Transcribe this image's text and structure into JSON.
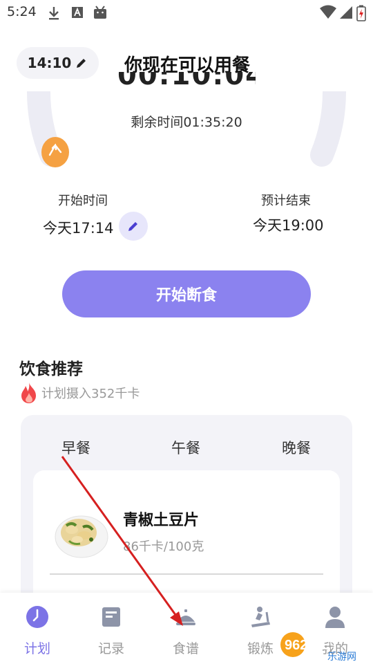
{
  "status_bar": {
    "time": "5:24"
  },
  "header": {
    "edit_time": "14:10",
    "title": "你现在可以用餐"
  },
  "timer": {
    "countdown": "00:10:04",
    "remaining": "剩余时间01:35:20"
  },
  "start": {
    "label": "开始时间",
    "value": "今天17:14"
  },
  "end": {
    "label": "预计结束",
    "value": "今天19:00"
  },
  "action_button": "开始断食",
  "diet": {
    "title": "饮食推荐",
    "plan": "计划摄入352千卡",
    "tabs": [
      "早餐",
      "午餐",
      "晚餐"
    ],
    "food": {
      "name": "青椒土豆片",
      "kcal": "86千卡/100克"
    }
  },
  "nav": {
    "items": [
      {
        "label": "计划",
        "icon": "clock-icon"
      },
      {
        "label": "记录",
        "icon": "notebook-icon"
      },
      {
        "label": "食谱",
        "icon": "recipe-icon"
      },
      {
        "label": "锻炼",
        "icon": "treadmill-icon"
      },
      {
        "label": "我的",
        "icon": "person-icon"
      }
    ]
  },
  "watermark": {
    "text": "962.NET",
    "subtext": "乐游网"
  },
  "colors": {
    "accent": "#8b82ef",
    "active_nav": "#7c73e6",
    "flame": "#f0474a",
    "arrow": "#d62020",
    "progress": "#f5a142"
  }
}
